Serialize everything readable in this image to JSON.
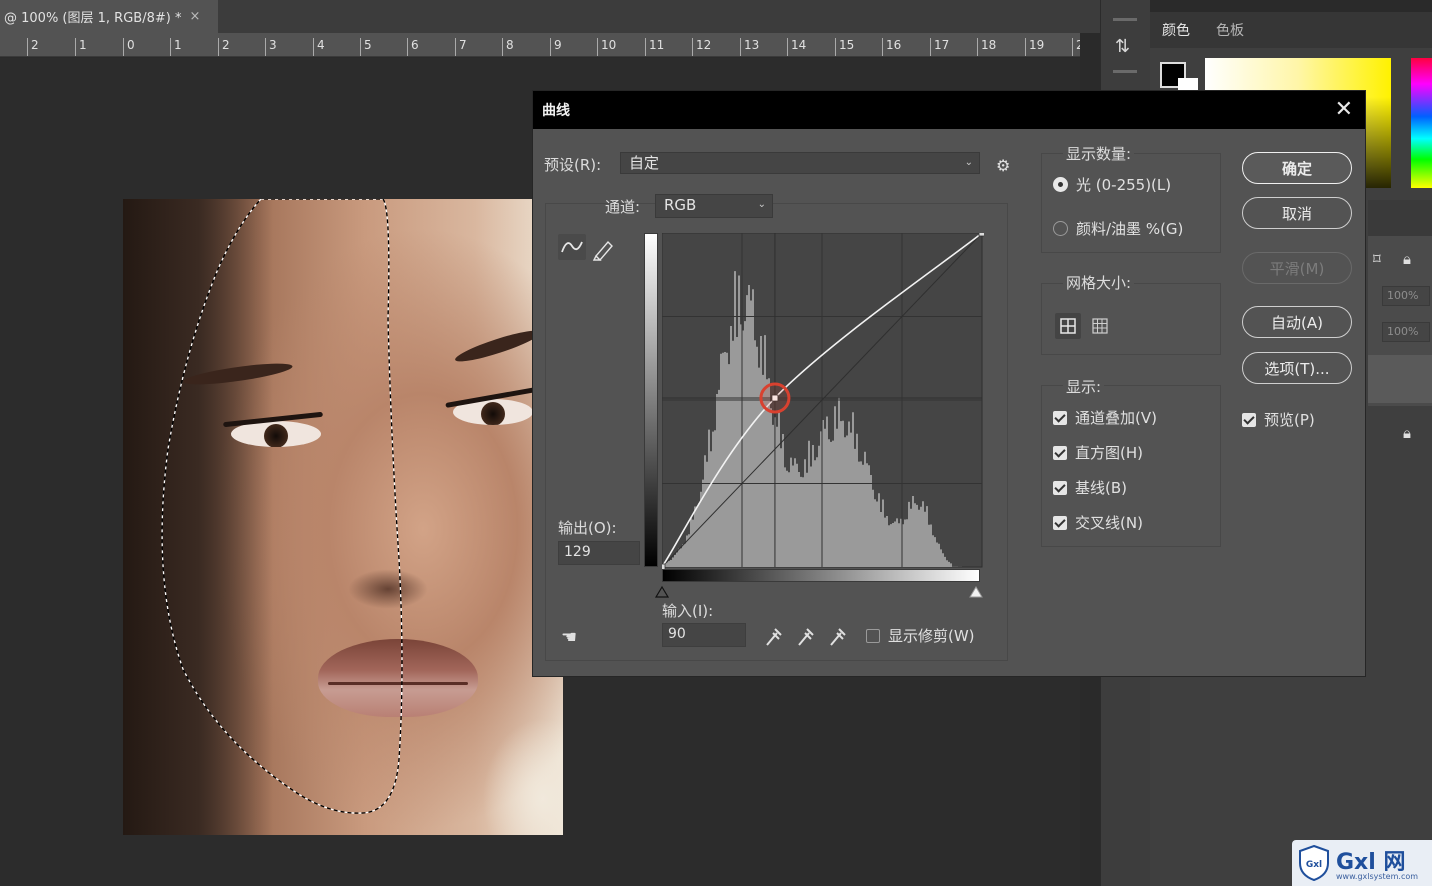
{
  "document": {
    "tab_title": "@ 100% (图层 1, RGB/8#) *",
    "close_glyph": "×",
    "ruler_labels": [
      "2",
      "1",
      "0",
      "1",
      "2",
      "3",
      "4",
      "5",
      "6",
      "7",
      "8",
      "9",
      "10",
      "11",
      "12",
      "13",
      "14",
      "15",
      "16",
      "17",
      "18",
      "19",
      "2"
    ]
  },
  "curves_dialog": {
    "title": "曲线",
    "close_glyph": "✕",
    "preset_label": "预设(R):",
    "preset_value": "自定",
    "channel_label": "通道:",
    "channel_value": "RGB",
    "output_label": "输出(O):",
    "output_value": "129",
    "input_label": "输入(I):",
    "input_value": "90",
    "show_clipping_label": "显示修剪(W)",
    "show_clipping_checked": false,
    "show_amount": {
      "heading": "显示数量:",
      "options": [
        {
          "label": "光 (0-255)(L)",
          "selected": true
        },
        {
          "label": "颜料/油墨 %(G)",
          "selected": false
        }
      ]
    },
    "grid_size": {
      "heading": "网格大小:"
    },
    "show": {
      "heading": "显示:",
      "options": [
        {
          "label": "通道叠加(V)",
          "checked": true
        },
        {
          "label": "直方图(H)",
          "checked": true
        },
        {
          "label": "基线(B)",
          "checked": true
        },
        {
          "label": "交叉线(N)",
          "checked": true
        }
      ]
    },
    "buttons": {
      "ok": "确定",
      "cancel": "取消",
      "smooth": "平滑(M)",
      "auto": "自动(A)",
      "options": "选项(T)..."
    },
    "preview_label": "预览(P)",
    "preview_checked": true
  },
  "curve_points": [
    {
      "input": 0,
      "output": 0
    },
    {
      "input": 90,
      "output": 129
    },
    {
      "input": 255,
      "output": 255
    }
  ],
  "right_panel": {
    "tabs": [
      "颜色",
      "色板"
    ],
    "opacity_value": "100%",
    "fill_value": "100%"
  },
  "watermark": {
    "brand": "Gxl 网",
    "badge": "Gxl",
    "url": "www.gxlsystem.com"
  },
  "colors": {
    "dialog_bg": "#535353",
    "title_bar": "#000000",
    "curve_color": "#f2f2f2",
    "control_point_highlight": "#d9412f"
  }
}
